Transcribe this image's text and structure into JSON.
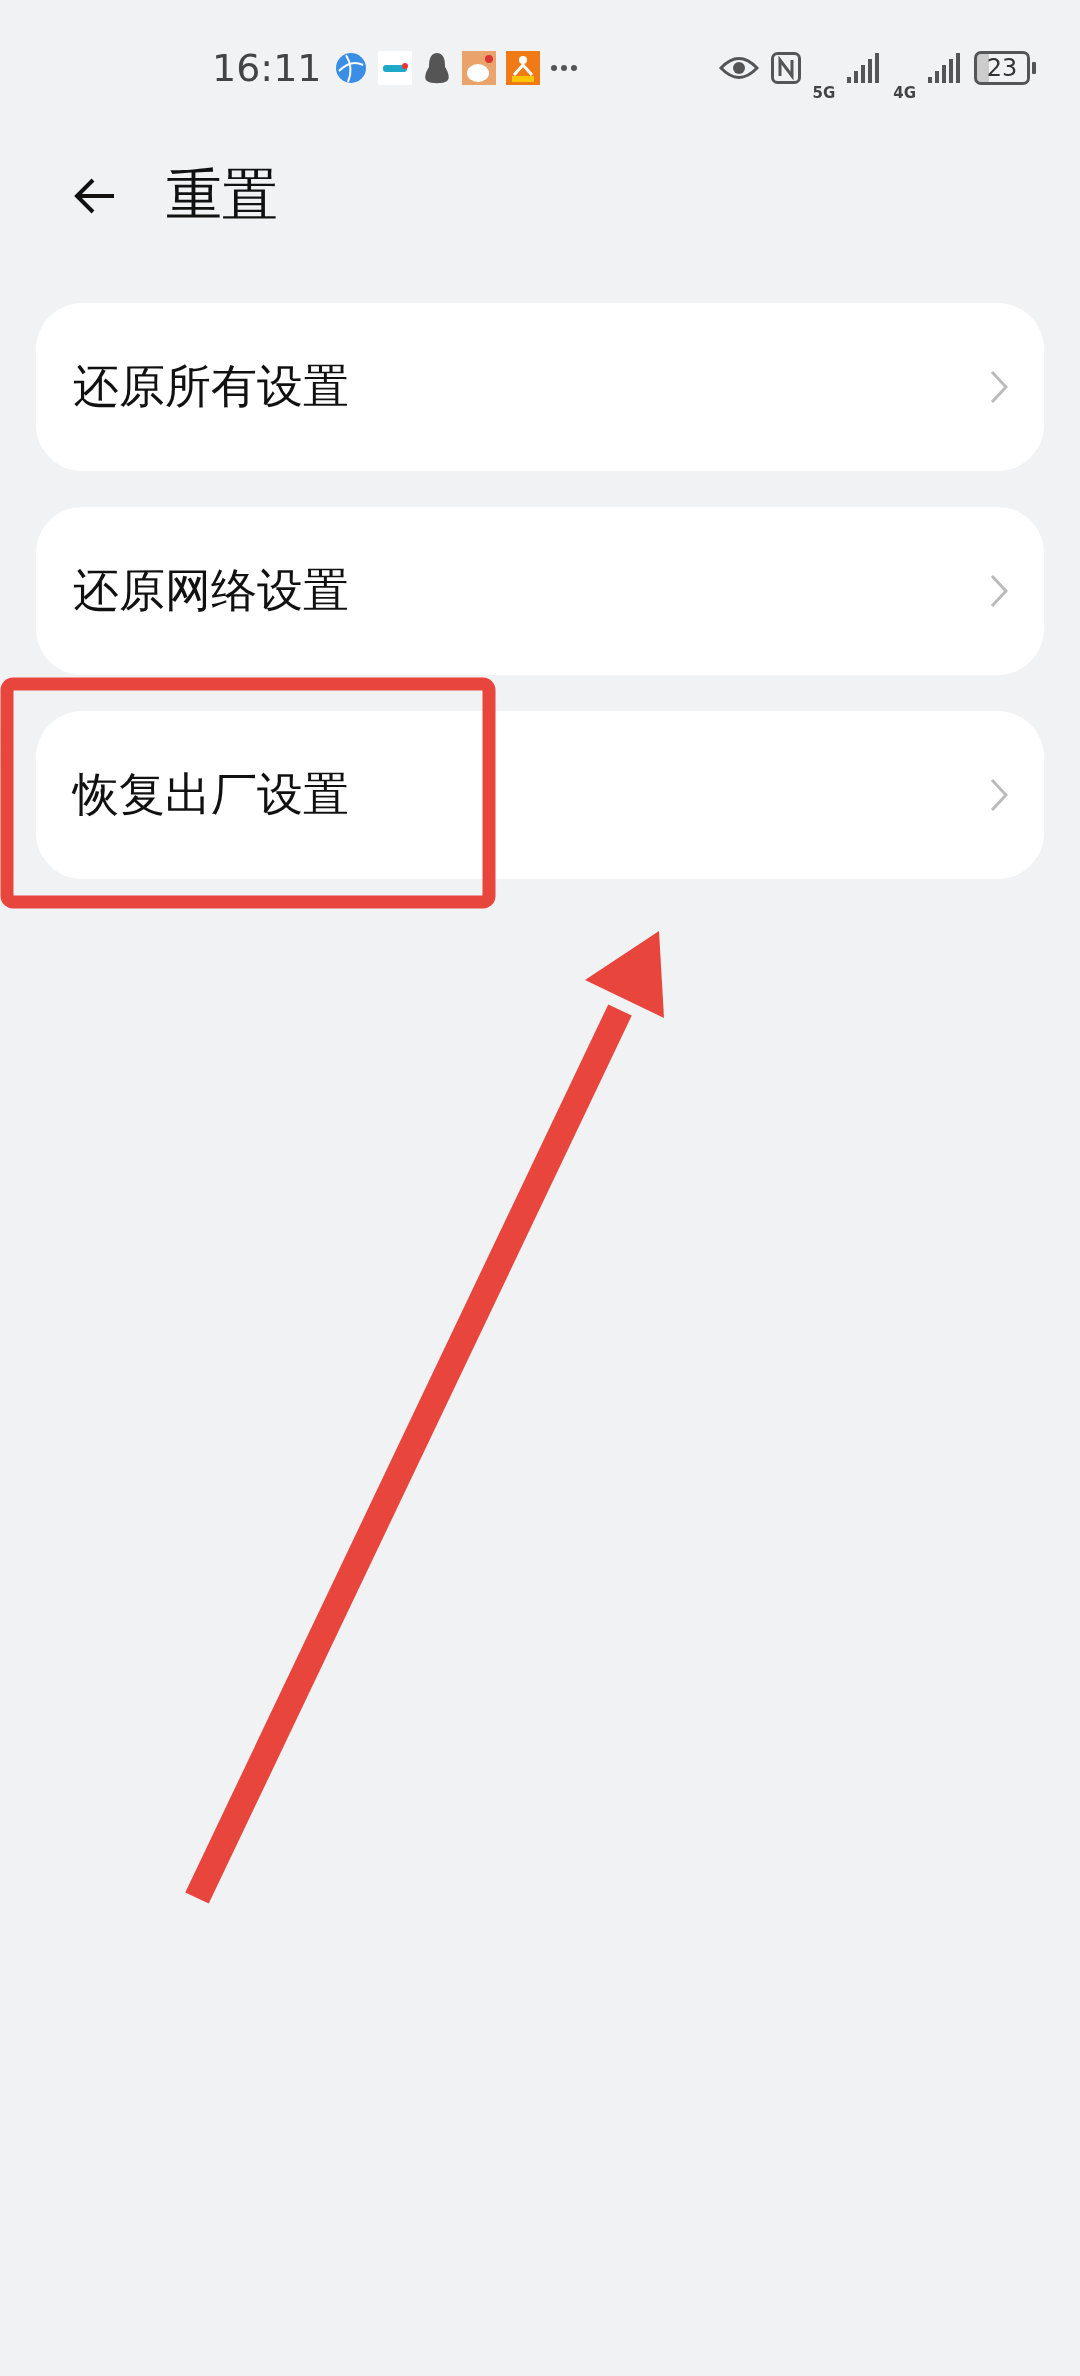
{
  "status_bar": {
    "time": "16:11",
    "network_1": "5G",
    "network_2": "4G",
    "battery": "23"
  },
  "header": {
    "title": "重置"
  },
  "items": [
    {
      "label": "还原所有设置"
    },
    {
      "label": "还原网络设置"
    },
    {
      "label": "恢复出厂设置"
    }
  ]
}
